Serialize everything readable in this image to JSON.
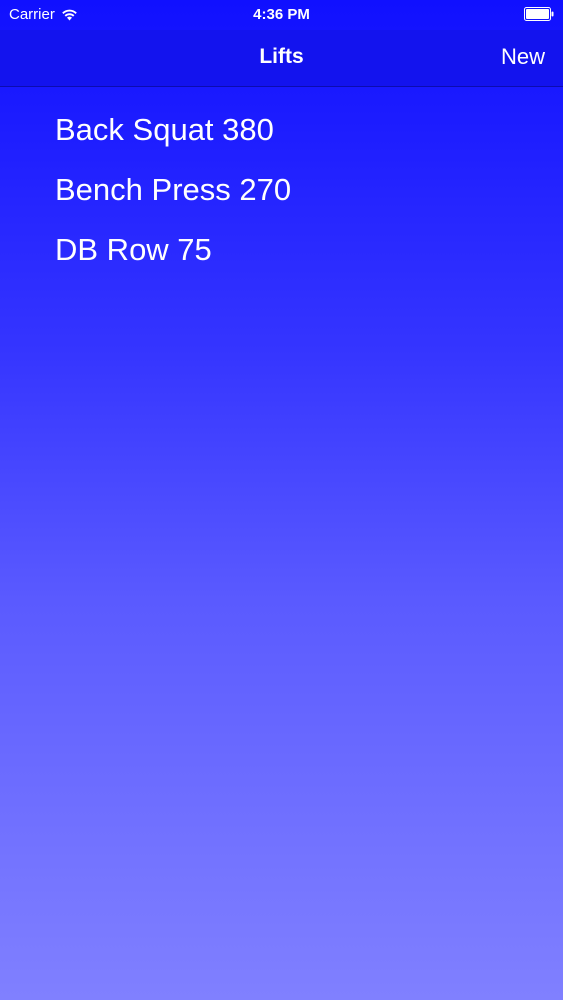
{
  "status_bar": {
    "carrier": "Carrier",
    "time": "4:36 PM",
    "wifi_icon": "wifi-icon",
    "battery_icon": "battery-icon"
  },
  "nav": {
    "title": "Lifts",
    "new_label": "New"
  },
  "lifts": [
    {
      "label": "Back Squat 380"
    },
    {
      "label": "Bench Press 270"
    },
    {
      "label": "DB Row 75"
    }
  ],
  "colors": {
    "nav_background": "#1313ee",
    "gradient_top": "#1010ff",
    "gradient_bottom": "#8080ff",
    "text": "#ffffff"
  }
}
